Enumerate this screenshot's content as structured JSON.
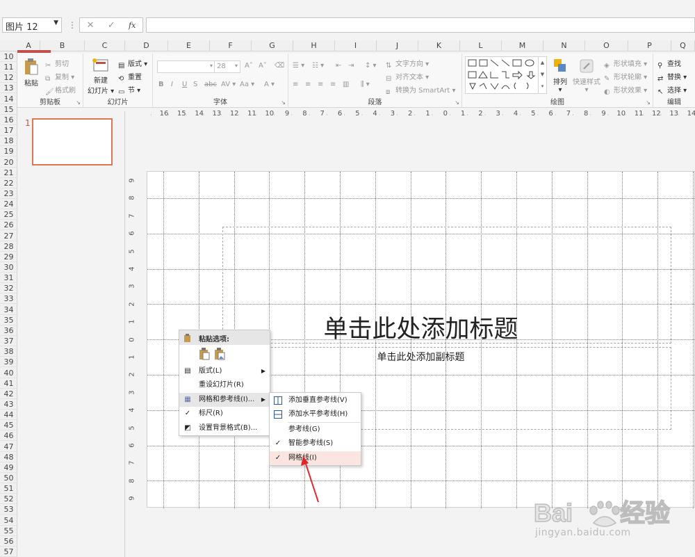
{
  "formula_bar": {
    "name_box": "图片 12",
    "fx": "fx"
  },
  "columns": [
    "A",
    "B",
    "C",
    "D",
    "E",
    "F",
    "G",
    "H",
    "I",
    "J",
    "K",
    "L",
    "M",
    "N",
    "O",
    "P",
    "Q"
  ],
  "rows": [
    "10",
    "11",
    "12",
    "13",
    "14",
    "15",
    "16",
    "17",
    "18",
    "19",
    "20",
    "21",
    "22",
    "23",
    "24",
    "25",
    "26",
    "27",
    "28",
    "29",
    "30",
    "31",
    "32",
    "33",
    "34",
    "35",
    "36",
    "37",
    "38",
    "39",
    "40",
    "41",
    "42",
    "43",
    "44",
    "45",
    "46",
    "47",
    "48",
    "49",
    "50",
    "51",
    "52",
    "53",
    "54",
    "55",
    "56",
    "57"
  ],
  "ribbon": {
    "clipboard": {
      "label": "剪贴板",
      "paste": "粘贴",
      "cut": "剪切",
      "copy": "复制",
      "format_painter": "格式刷"
    },
    "slides": {
      "label": "幻灯片",
      "new_slide_1": "新建",
      "new_slide_2": "幻灯片",
      "layout": "版式",
      "reset": "重置",
      "section": "节"
    },
    "font": {
      "label": "字体",
      "font_size": "28"
    },
    "paragraph": {
      "label": "段落",
      "text_direction": "文字方向",
      "align_text": "对齐文本",
      "convert_smartart": "转换为 SmartArt"
    },
    "drawing": {
      "label": "绘图",
      "arrange": "排列",
      "quick_styles": "快速样式",
      "shape_fill": "形状填充",
      "shape_outline": "形状轮廓",
      "shape_effects": "形状效果"
    },
    "editing": {
      "label": "编辑",
      "find": "查找",
      "replace": "替换",
      "select": "选择"
    }
  },
  "h_ruler": [
    "16",
    "15",
    "14",
    "13",
    "12",
    "11",
    "10",
    "9",
    "8",
    "7",
    "6",
    "5",
    "4",
    "3",
    "2",
    "1",
    "0",
    "1",
    "2",
    "3",
    "4",
    "5",
    "6",
    "7",
    "8",
    "9",
    "10",
    "11",
    "12",
    "13",
    "14"
  ],
  "v_ruler": [
    "9",
    "8",
    "7",
    "6",
    "5",
    "4",
    "3",
    "2",
    "1",
    "0",
    "1",
    "2",
    "3",
    "4",
    "5",
    "6",
    "7",
    "8",
    "9"
  ],
  "thumbnail": {
    "number": "1"
  },
  "slide": {
    "title": "单击此处添加标题",
    "subtitle": "单击此处添加副标题"
  },
  "context_menu": {
    "paste_options": "粘贴选项:",
    "layout": "版式(L)",
    "reset_slide": "重设幻灯片(R)",
    "grid_guides": "网格和参考线(I)...",
    "ruler": "标尺(R)",
    "format_background": "设置背景格式(B)..."
  },
  "submenu": {
    "add_vertical_guide": "添加垂直参考线(V)",
    "add_horizontal_guide": "添加水平参考线(H)",
    "guides": "参考线(G)",
    "smart_guides": "智能参考线(S)",
    "gridlines": "网格线(I)"
  },
  "watermark": {
    "brand": "Bai du 经验",
    "url": "jingyan.baidu.com"
  },
  "colors": {
    "accent": "#c0504d",
    "thumb_border": "#e0754f",
    "arrow": "#e0262b"
  }
}
